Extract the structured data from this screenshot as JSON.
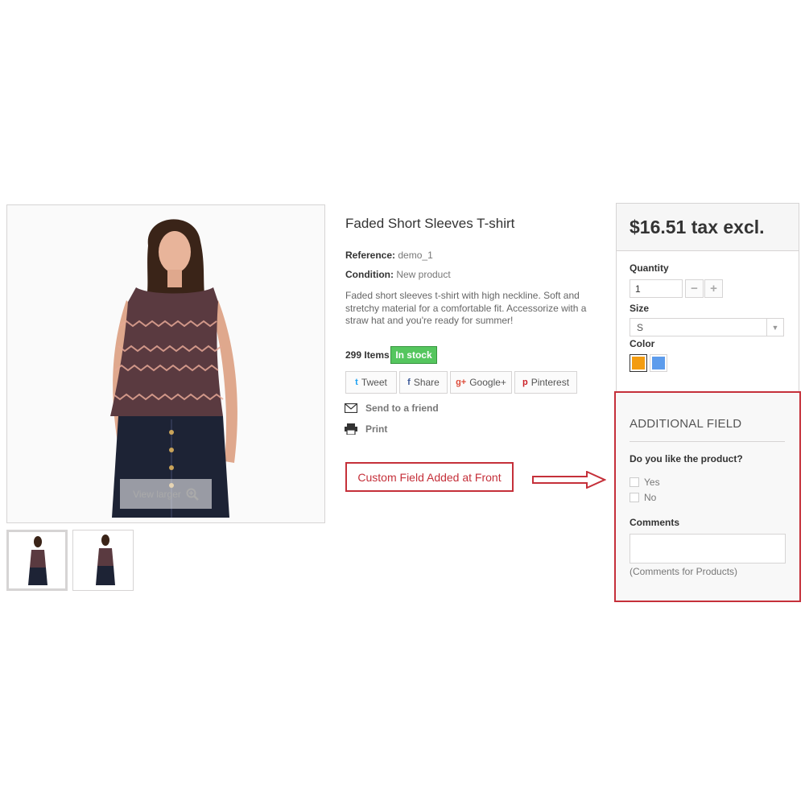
{
  "product": {
    "title": "Faded Short Sleeves T-shirt",
    "reference_label": "Reference:",
    "reference_value": "demo_1",
    "condition_label": "Condition:",
    "condition_value": "New product",
    "description": "Faded short sleeves t-shirt with high neckline. Soft and stretchy material for a comfortable fit. Accessorize with a straw hat and you're ready for summer!",
    "items_count": "299 Items",
    "stock_status": "In stock",
    "view_larger": "View larger"
  },
  "share": [
    {
      "icon": "twitter-icon",
      "glyph": "t",
      "label": "Tweet",
      "color": "#1da1f2"
    },
    {
      "icon": "facebook-icon",
      "glyph": "f",
      "label": "Share",
      "color": "#3b5998"
    },
    {
      "icon": "google-plus-icon",
      "glyph": "g+",
      "label": "Google+",
      "color": "#dd4b39"
    },
    {
      "icon": "pinterest-icon",
      "glyph": "p",
      "label": "Pinterest",
      "color": "#cb2027"
    }
  ],
  "actions": {
    "send_to_friend": "Send to a friend",
    "print": "Print"
  },
  "callout": {
    "text": "Custom Field Added at Front"
  },
  "cart": {
    "price": "$16.51 tax excl.",
    "quantity_label": "Quantity",
    "quantity_value": "1",
    "size_label": "Size",
    "size_value": "S",
    "color_label": "Color",
    "colors": [
      "#f39c11",
      "#5d9cec"
    ]
  },
  "additional_field": {
    "title": "ADDITIONAL FIELD",
    "question": "Do you like the product?",
    "options": [
      "Yes",
      "No"
    ],
    "comments_label": "Comments",
    "comments_help": "(Comments for Products)"
  },
  "colors": {
    "accent_red": "#c5303a",
    "stock_green": "#55c65e"
  }
}
